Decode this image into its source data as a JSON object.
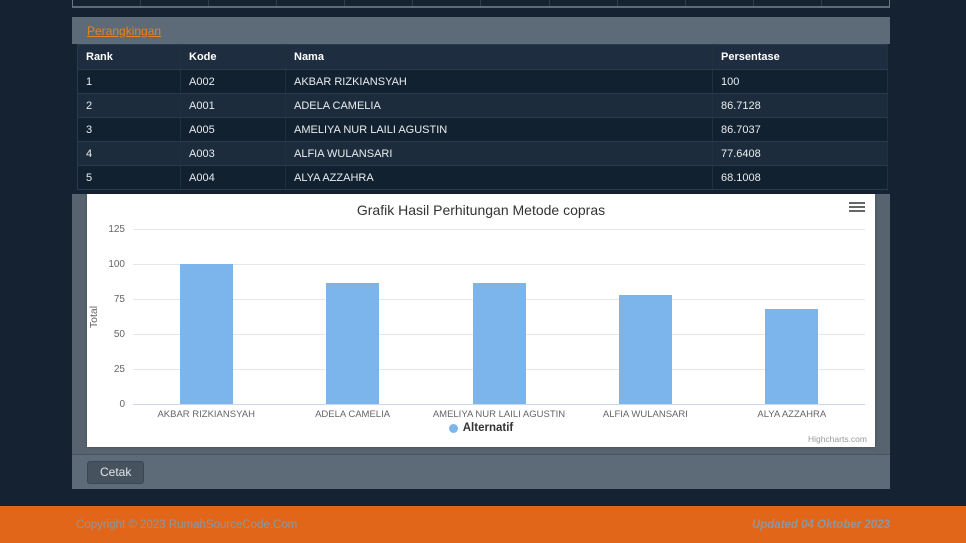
{
  "ranking_panel": {
    "title_link": "Perangkingan",
    "table": {
      "headers": [
        "Rank",
        "Kode",
        "Nama",
        "Persentase"
      ],
      "rows": [
        {
          "rank": "1",
          "kode": "A002",
          "nama": "AKBAR RIZKIANSYAH",
          "persentase": "100"
        },
        {
          "rank": "2",
          "kode": "A001",
          "nama": "ADELA CAMELIA",
          "persentase": "86.7128"
        },
        {
          "rank": "3",
          "kode": "A005",
          "nama": "AMELIYA NUR LAILI AGUSTIN",
          "persentase": "86.7037"
        },
        {
          "rank": "4",
          "kode": "A003",
          "nama": "ALFIA WULANSARI",
          "persentase": "77.6408"
        },
        {
          "rank": "5",
          "kode": "A004",
          "nama": "ALYA AZZAHRA",
          "persentase": "68.1008"
        }
      ]
    }
  },
  "chart_data": {
    "type": "bar",
    "title": "Grafik Hasil Perhitungan Metode copras",
    "categories": [
      "AKBAR RIZKIANSYAH",
      "ADELA CAMELIA",
      "AMELIYA NUR LAILI AGUSTIN",
      "ALFIA WULANSARI",
      "ALYA AZZAHRA"
    ],
    "series": [
      {
        "name": "Alternatif",
        "color": "#7cb5ec",
        "values": [
          100,
          86.7128,
          86.7037,
          77.6408,
          68.1008
        ]
      }
    ],
    "xlabel": "",
    "ylabel": "Total",
    "ylim": [
      0,
      125
    ],
    "yticks": [
      0,
      25,
      50,
      75,
      100,
      125
    ],
    "grid": true,
    "legend_position": "bottom-center",
    "credits": "Highcharts.com"
  },
  "actions": {
    "print_label": "Cetak"
  },
  "footer": {
    "copyright": "Copyright © 2023 RumahSourceCode.Com",
    "updated": "Updated 04 Oktober 2023"
  },
  "colors": {
    "accent_orange": "#e2661a",
    "link_orange": "#e8821e",
    "bar_blue": "#7cb5ec",
    "page_bg": "#152231",
    "panel_gray": "#5d6b79"
  }
}
